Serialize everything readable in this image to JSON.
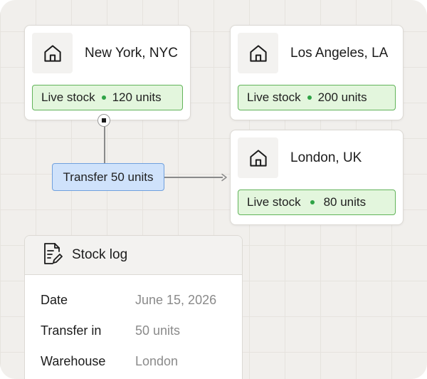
{
  "warehouses": [
    {
      "name": "New York, NYC",
      "stock_label": "Live stock",
      "stock_value": "120 units"
    },
    {
      "name": "Los Angeles, LA",
      "stock_label": "Live stock",
      "stock_value": "200 units"
    },
    {
      "name": "London, UK",
      "stock_label": "Live stock",
      "stock_value": "80 units"
    }
  ],
  "transfer": {
    "label": "Transfer 50 units"
  },
  "stock_log": {
    "title": "Stock log",
    "rows": [
      {
        "key": "Date",
        "value": "June 15, 2026"
      },
      {
        "key": "Transfer in",
        "value": "50 units"
      },
      {
        "key": "Warehouse",
        "value": "London"
      }
    ]
  },
  "colors": {
    "stock_bg": "#e3f6dd",
    "stock_border": "#62b45a",
    "stock_dot": "#2fa346",
    "transfer_bg": "#cfe2fb",
    "transfer_border": "#6fa0de"
  },
  "icons": {
    "warehouse": "house-icon",
    "log": "document-edit-icon",
    "handle": "connector-handle-icon",
    "arrow": "arrow-right-icon"
  }
}
